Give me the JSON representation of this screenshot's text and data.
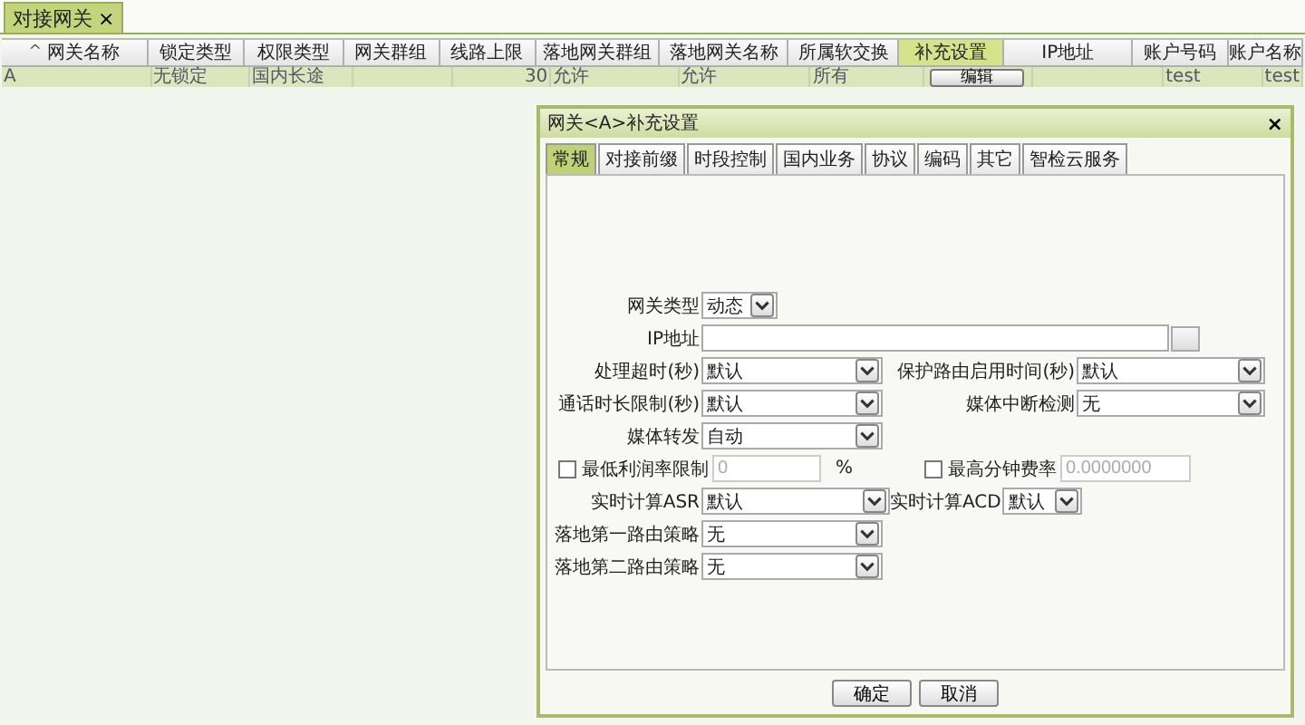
{
  "doc_tabs": [
    {
      "label": "对接网关",
      "close": "×",
      "selected": true
    }
  ],
  "table": {
    "columns": [
      {
        "label": "网关名称",
        "sort_mark": "^",
        "selected": false
      },
      {
        "label": "锁定类型",
        "selected": false
      },
      {
        "label": "权限类型",
        "selected": false
      },
      {
        "label": "网关群组",
        "selected": false
      },
      {
        "label": "线路上限",
        "selected": false
      },
      {
        "label": "落地网关群组",
        "selected": false
      },
      {
        "label": "落地网关名称",
        "selected": false
      },
      {
        "label": "所属软交换",
        "selected": false
      },
      {
        "label": "补充设置",
        "selected": true
      },
      {
        "label": "IP地址",
        "selected": false
      },
      {
        "label": "账户号码",
        "selected": false
      },
      {
        "label": "账户名称",
        "selected": false
      }
    ],
    "rows": [
      {
        "selected": true,
        "cells": [
          {
            "kind": "text",
            "text": "A"
          },
          {
            "kind": "text",
            "text": "无锁定"
          },
          {
            "kind": "text",
            "text": "国内长途"
          },
          {
            "kind": "text",
            "text": ""
          },
          {
            "kind": "number",
            "text": "30"
          },
          {
            "kind": "text",
            "text": "允许"
          },
          {
            "kind": "text",
            "text": "允许"
          },
          {
            "kind": "text",
            "text": "所有"
          },
          {
            "kind": "button",
            "text": "编辑"
          },
          {
            "kind": "text",
            "text": ""
          },
          {
            "kind": "text",
            "text": "test"
          },
          {
            "kind": "text",
            "text": "test"
          }
        ]
      }
    ]
  },
  "dialog": {
    "title": "网关<A>补充设置",
    "close": "×",
    "tabs": [
      {
        "label": "常规",
        "selected": true
      },
      {
        "label": "对接前缀",
        "selected": false
      },
      {
        "label": "时段控制",
        "selected": false
      },
      {
        "label": "国内业务",
        "selected": false
      },
      {
        "label": "协议",
        "selected": false
      },
      {
        "label": "编码",
        "selected": false
      },
      {
        "label": "其它",
        "selected": false
      },
      {
        "label": "智检云服务",
        "selected": false
      }
    ],
    "form_rows": [
      {
        "items": [
          {
            "kind": "select",
            "label": "网关类型",
            "value": "动态"
          }
        ]
      },
      {
        "items": [
          {
            "kind": "text",
            "label": "IP地址",
            "value": ""
          }
        ]
      },
      {
        "items": [
          {
            "kind": "select",
            "label": "处理超时(秒)",
            "value": "默认"
          },
          {
            "kind": "select",
            "label": "保护路由启用时间(秒)",
            "value": "默认"
          }
        ]
      },
      {
        "items": [
          {
            "kind": "select",
            "label": "通话时长限制(秒)",
            "value": "默认"
          },
          {
            "kind": "select",
            "label": "媒体中断检测",
            "value": "无"
          }
        ]
      },
      {
        "items": [
          {
            "kind": "select",
            "label": "媒体转发",
            "value": "自动"
          }
        ]
      },
      {
        "items": [
          {
            "kind": "check",
            "label": "最低利润率限制",
            "checked": false,
            "value": "0",
            "unit": "%",
            "disabled": true
          },
          {
            "kind": "check",
            "label": "最高分钟费率",
            "checked": false,
            "value": "0.0000000",
            "disabled": true
          }
        ]
      },
      {
        "items": [
          {
            "kind": "select",
            "label": "实时计算ASR",
            "value": "默认"
          },
          {
            "kind": "select",
            "label": "实时计算ACD",
            "value": "默认"
          }
        ]
      },
      {
        "items": [
          {
            "kind": "select",
            "label": "落地第一路由策略",
            "value": "无"
          }
        ]
      },
      {
        "items": [
          {
            "kind": "select",
            "label": "落地第二路由策略",
            "value": "无"
          }
        ]
      }
    ],
    "buttons": [
      "确定",
      "取消"
    ]
  }
}
